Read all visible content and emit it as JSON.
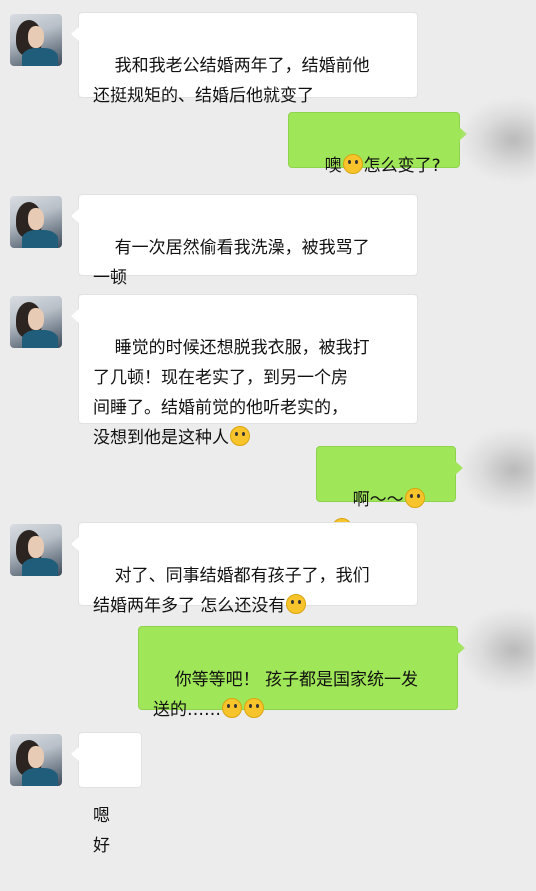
{
  "messages": [
    {
      "side": "left",
      "text": "我和我老公结婚两年了，结婚前他\n还挺规矩的、结婚后他就变了"
    },
    {
      "side": "right",
      "text_before": "噢",
      "text_after": "怎么变了?",
      "emojis": [
        "surprised-emoji"
      ]
    },
    {
      "side": "left",
      "text": "有一次居然偷看我洗澡，被我骂了\n一顿"
    },
    {
      "side": "left",
      "text": "睡觉的时候还想脱我衣服，被我打\n了几顿！现在老实了，到另一个房\n间睡了。结婚前觉的他听老实的，\n没想到他是这种人",
      "emojis": [
        "dizzy-emoji"
      ]
    },
    {
      "side": "right",
      "text": "啊～～",
      "emojis": [
        "scream-emoji",
        "scream-emoji"
      ]
    },
    {
      "side": "left",
      "text": "对了、同事结婚都有孩子了，我们\n结婚两年多了 怎么还没有",
      "emojis": [
        "dizzy-emoji"
      ]
    },
    {
      "side": "right",
      "text": "你等等吧！ 孩子都是国家统一发\n送的……",
      "emojis": [
        "smirk-emoji",
        "smirk-emoji"
      ]
    },
    {
      "side": "left",
      "text": "嗯 好"
    }
  ],
  "colors": {
    "background": "#ececec",
    "incoming_bubble": "#ffffff",
    "outgoing_bubble": "#9fe658"
  }
}
